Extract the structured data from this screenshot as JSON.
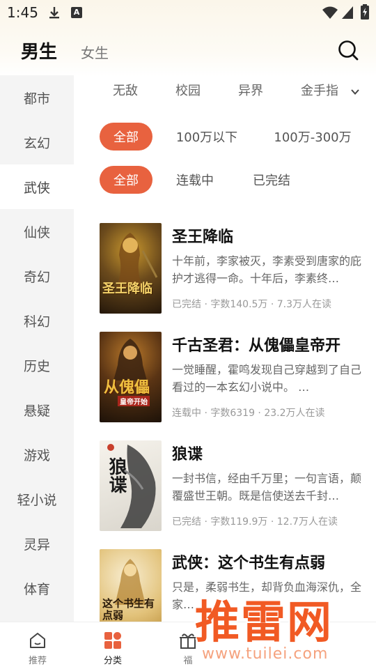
{
  "status_bar": {
    "time": "1:45",
    "a_badge": "A"
  },
  "header": {
    "tab_male": "男生",
    "tab_female": "女生"
  },
  "sidebar": {
    "items": [
      {
        "label": "都市"
      },
      {
        "label": "玄幻"
      },
      {
        "label": "武侠"
      },
      {
        "label": "仙侠"
      },
      {
        "label": "奇幻"
      },
      {
        "label": "科幻"
      },
      {
        "label": "历史"
      },
      {
        "label": "悬疑"
      },
      {
        "label": "游戏"
      },
      {
        "label": "轻小说"
      },
      {
        "label": "灵异"
      },
      {
        "label": "体育"
      }
    ],
    "active_index": 2
  },
  "subcategories": [
    {
      "label": "无敌"
    },
    {
      "label": "校园"
    },
    {
      "label": "异界"
    },
    {
      "label": "金手指"
    }
  ],
  "word_filter": [
    {
      "label": "全部"
    },
    {
      "label": "100万以下"
    },
    {
      "label": "100万-300万"
    }
  ],
  "status_filter": [
    {
      "label": "全部"
    },
    {
      "label": "连载中"
    },
    {
      "label": "已完结"
    }
  ],
  "books": [
    {
      "title": "圣王降临",
      "desc": "十年前，李家被灭，李素受到唐家的庇护才逃得一命。十年后，李素终…",
      "meta": "已完结 · 字数140.5万 · 7.3万人在读",
      "cover_text": "圣王降临",
      "cover_colors": [
        "#3a2a14",
        "#c9982e"
      ]
    },
    {
      "title": "千古圣君：从傀儡皇帝开",
      "desc": "一觉睡醒，霍鸣发现自己穿越到了自己看过的一本玄幻小说中。 …",
      "meta": "连载中 · 字数6319 · 23.2万人在读",
      "cover_text": "从傀儡",
      "cover_subtext": "皇帝开始",
      "cover_colors": [
        "#2b1a0c",
        "#b8782a"
      ]
    },
    {
      "title": "狼谍",
      "desc": "一封书信，经由千万里；一句言语，颠覆盛世王朝。既是信使送去千封…",
      "meta": "已完结 · 字数119.9万 · 12.7万人在读",
      "cover_text": "狼谍",
      "cover_colors": [
        "#f2efe8",
        "#4a4a4a"
      ]
    },
    {
      "title": "武侠：这个书生有点弱",
      "desc": "只是，柔弱书生，却背负血海深仇，全家…",
      "meta": "",
      "cover_text": "这个书生有点弱",
      "cover_colors": [
        "#f3e6c4",
        "#d2a84a"
      ]
    }
  ],
  "bottom_nav": [
    {
      "label": "推荐",
      "icon": "home-icon"
    },
    {
      "label": "分类",
      "icon": "category-icon"
    },
    {
      "label": "福",
      "icon": "gift-icon"
    }
  ],
  "watermark": {
    "main": "推雷网",
    "url": "www.tuilei.com"
  },
  "colors": {
    "accent": "#e8623f",
    "sidebar_bg": "#f4f4f4",
    "watermark": "#f15a24"
  }
}
